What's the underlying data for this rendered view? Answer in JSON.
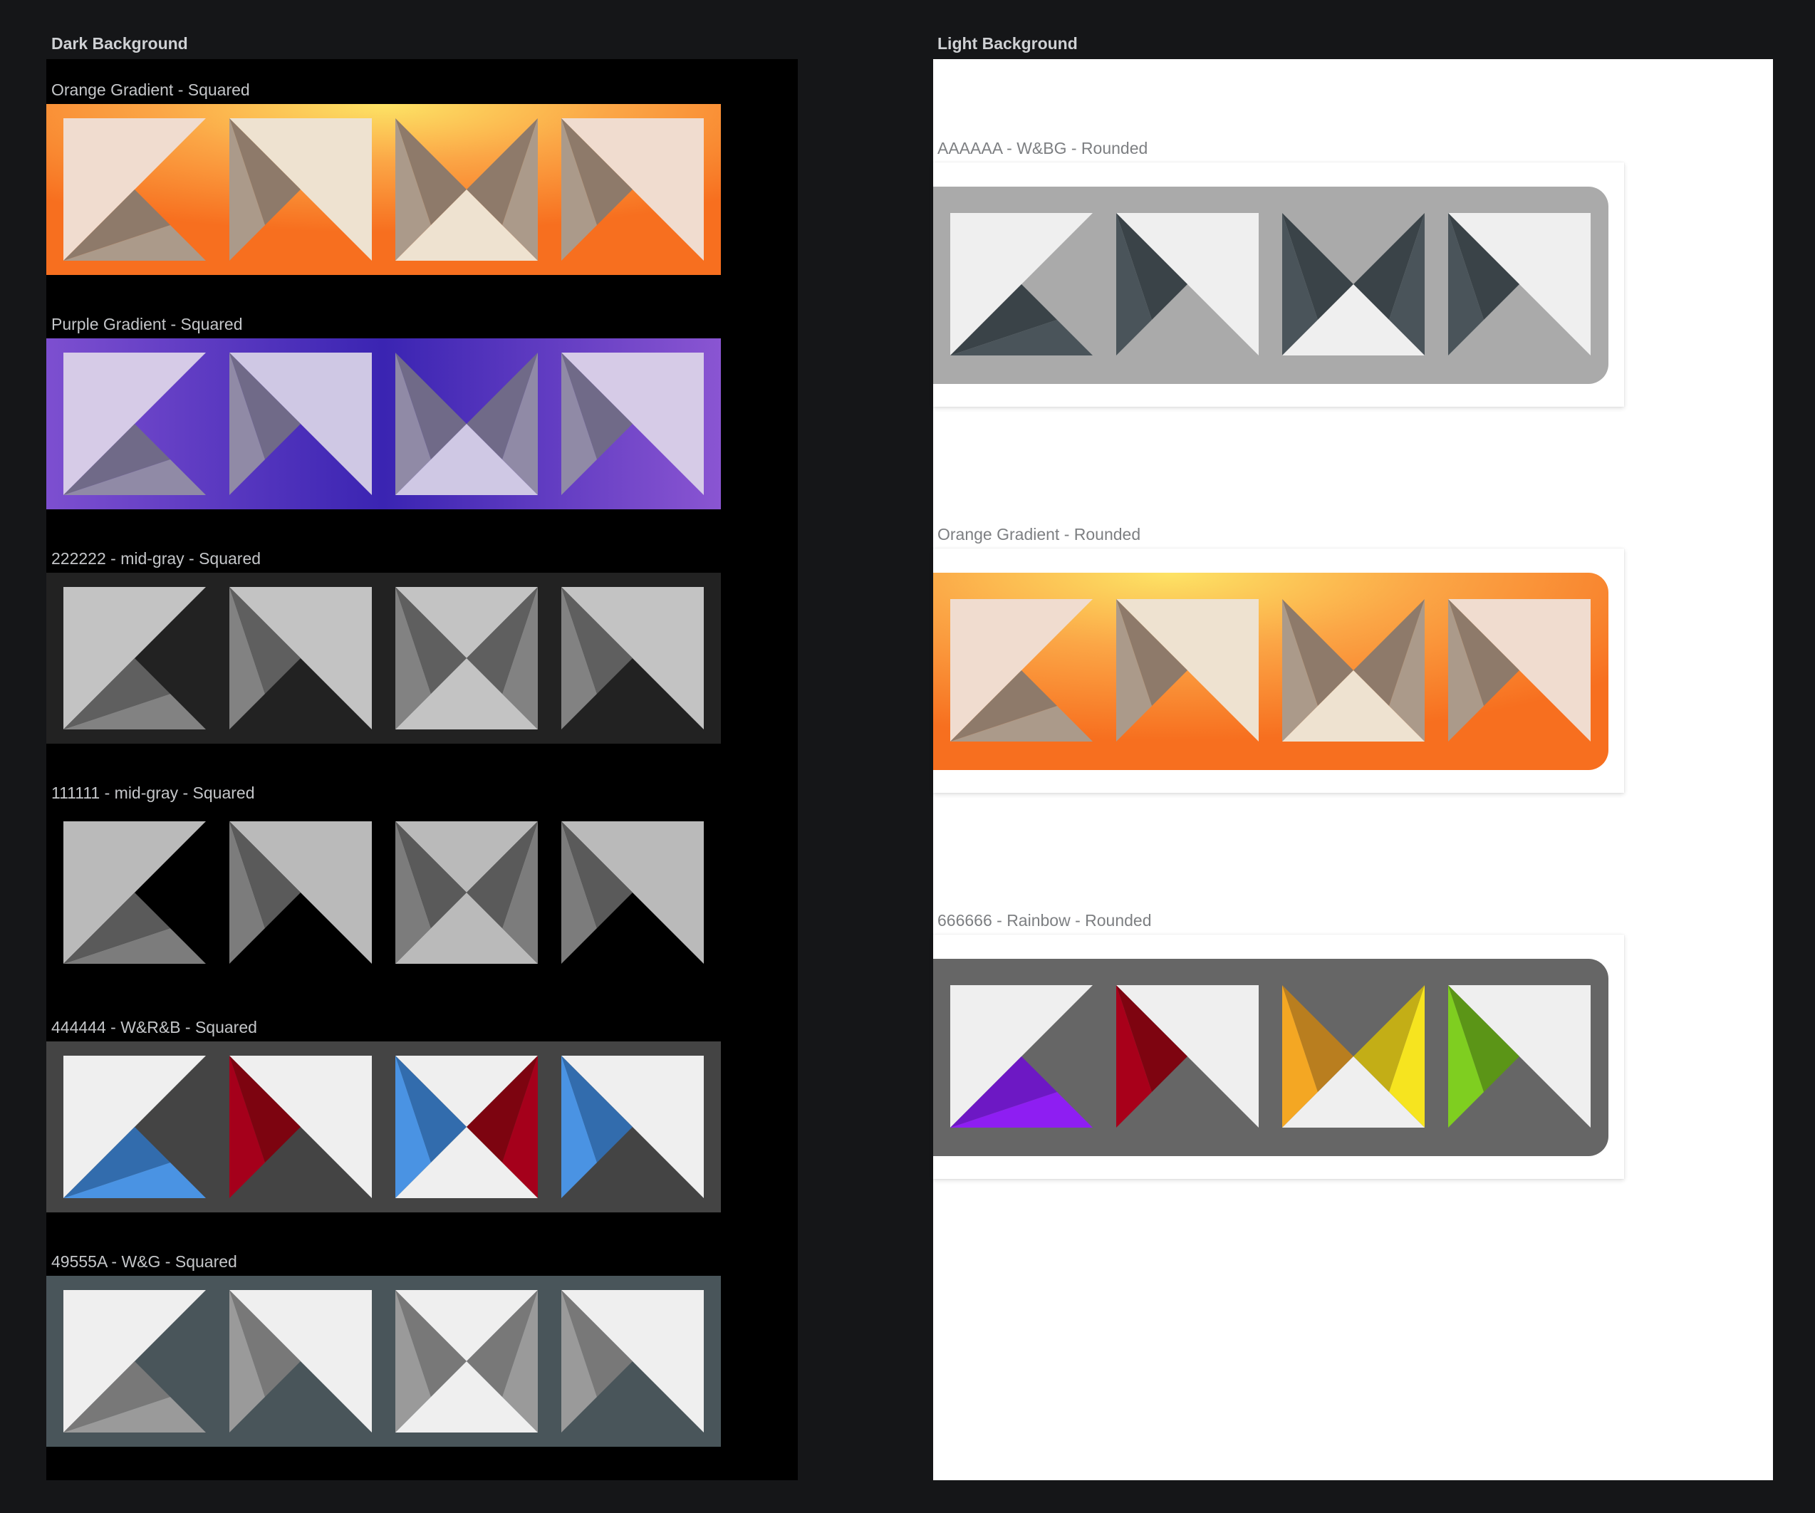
{
  "dark_canvas": {
    "title": "Dark Background",
    "frames": [
      {
        "label": "Orange Gradient - Squared",
        "fill": "gradient:orange",
        "panel": "#f0dccf",
        "shadow": "#8e7a6a",
        "shade": "#ab9a8a",
        "pale": "#eee2d0"
      },
      {
        "label": "Purple Gradient - Squared",
        "fill": "gradient:purple",
        "panel": "#d6cbe7",
        "shadow": "#706a88",
        "shade": "#908aa6",
        "pale": "#cfc8e4"
      },
      {
        "label": "222222 - mid-gray - Squared",
        "fill": "#222222",
        "panel": "#c3c3c3",
        "shadow": "#5f5f5f",
        "shade": "#828282",
        "pale": "#c3c3c3"
      },
      {
        "label": "111111 - mid-gray - Squared",
        "fill": "#000000",
        "panel": "#bababa",
        "shadow": "#5a5a5a",
        "shade": "#7c7c7c",
        "pale": "#bababa"
      },
      {
        "label": "444444 - W&R&B - Squared",
        "fill": "#444444",
        "panel": "#efefef",
        "shadow": "#326cad",
        "shade": "#4a93e3",
        "pale": "#efefef"
      },
      {
        "label": "49555A - W&G -  Squared",
        "fill": "#49555a",
        "panel": "#efefef",
        "shadow": "#787878",
        "shade": "#9a9a9a",
        "pale": "#efefef"
      }
    ]
  },
  "light_canvas": {
    "title": "Light Background",
    "frames": [
      {
        "label": "AAAAAA - W&BG - Rounded",
        "fill": "#aaaaaa",
        "panel": "#efefef",
        "shadow": "#3a4348",
        "shade": "#4a545a",
        "pale": "#efefef"
      },
      {
        "label": "Orange Gradient - Rounded",
        "fill": "gradient:orange",
        "panel": "#f0dccf",
        "shadow": "#8e7a6a",
        "shade": "#ab9a8a",
        "pale": "#eee2d0"
      },
      {
        "label": "666666 - Rainbow - Rounded",
        "fill": "#666666",
        "panel": "#efefef",
        "shadow": "#6d18c4",
        "shade": "#8e1ef2",
        "pale": "#efefef"
      }
    ]
  },
  "icon_names": [
    "envelope-fold-left-icon",
    "envelope-fold-right-icon",
    "envelope-bowtie-icon",
    "envelope-corner-icon"
  ],
  "rainbow_colors": {
    "purple": [
      "#6d18c4",
      "#8e1ef2"
    ],
    "red": [
      "#7e0410",
      "#a8001a"
    ],
    "orange_yellow": [
      "#b97e1f",
      "#f4a723",
      "#c3ae16",
      "#f6e41f"
    ],
    "green": [
      "#5b9517",
      "#7fce20"
    ]
  },
  "accent_colors": {
    "red": [
      "#7d0410",
      "#a5001b"
    ],
    "blue": [
      "#326cad",
      "#4a93e3"
    ]
  }
}
